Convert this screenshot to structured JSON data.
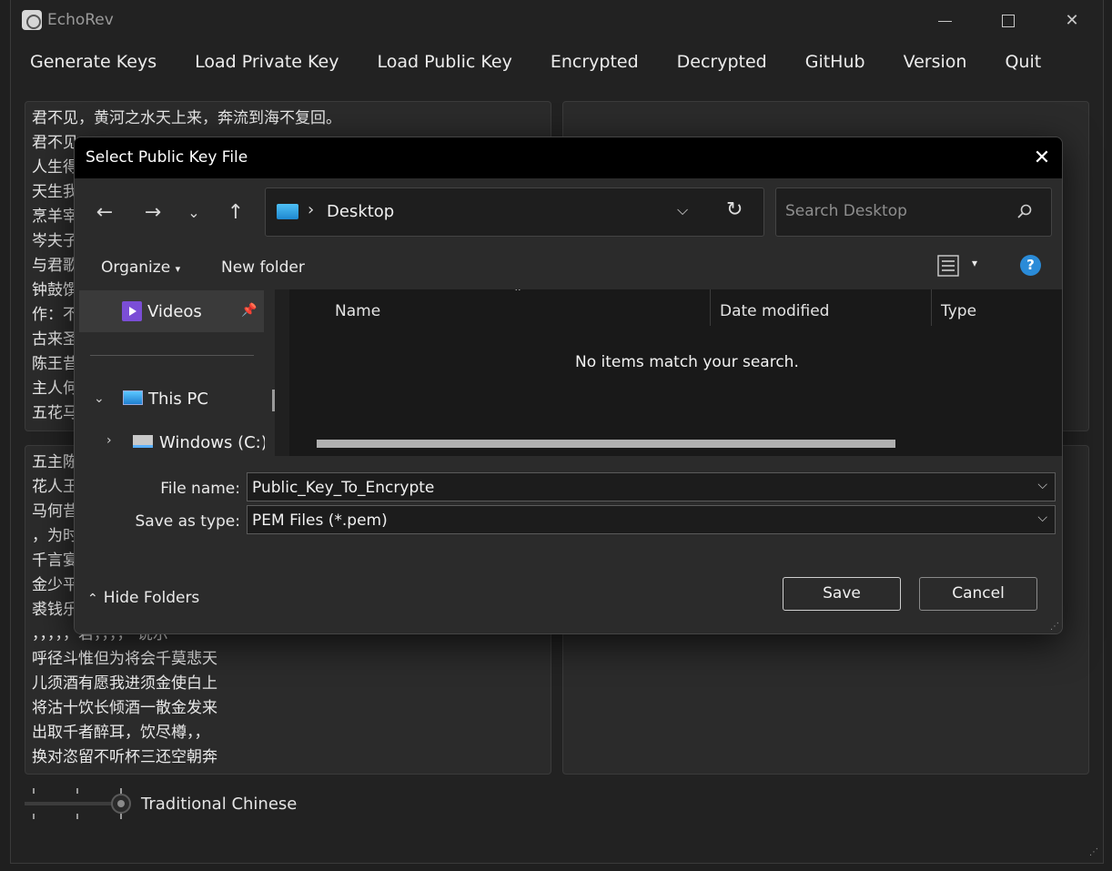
{
  "app": {
    "title": "EchoRev",
    "window_controls": {
      "minimize": "—",
      "maximize": "",
      "close": "✕"
    }
  },
  "menu": {
    "items": [
      "Generate Keys",
      "Load Private Key",
      "Load Public Key",
      "Encrypted",
      "Decrypted",
      "GitHub",
      "Version",
      "Quit"
    ]
  },
  "panels": {
    "top_left_lines": [
      "君不见，黄河之水天上来，奔流到海不复回。",
      "君不见",
      "人生得",
      "天生我",
      "烹羊宰",
      "岑夫子",
      "与君歌",
      "钟鼓馔",
      "作：不",
      "古来圣",
      "陈王昔",
      "主人何",
      "五花马"
    ],
    "bottom_left_lines": [
      "五主陈",
      "花人王",
      "马何昔",
      "，为时",
      "千言宴",
      "金少平",
      "裘钱乐",
      "，，，，，君，，，，  说示",
      "呼径斗惟但为将会千莫悲天",
      "儿须酒有愿我进须金使白上",
      "将沽十饮长倾酒一散金发来",
      "出取千者醉耳，饮尽樽，，",
      "换对恣留不听杯三还空朝奔"
    ]
  },
  "slider": {
    "label": "Traditional Chinese"
  },
  "dialog": {
    "title": "Select Public Key File",
    "address": {
      "location": "Desktop",
      "separator": "›"
    },
    "search": {
      "placeholder": "Search Desktop"
    },
    "commands": {
      "organize": "Organize",
      "new_folder": "New folder",
      "help": "?"
    },
    "nav_pane": {
      "videos": "Videos",
      "this_pc": "This PC",
      "drive": "Windows (C:)"
    },
    "columns": {
      "name": "Name",
      "date_modified": "Date modified",
      "type": "Type"
    },
    "empty_message": "No items match your search.",
    "file_name": {
      "label": "File name:",
      "value": "Public_Key_To_Encrypte"
    },
    "save_as_type": {
      "label": "Save as type:",
      "value": "PEM Files (*.pem)"
    },
    "hide_folders": "Hide Folders",
    "buttons": {
      "save": "Save",
      "cancel": "Cancel"
    }
  }
}
